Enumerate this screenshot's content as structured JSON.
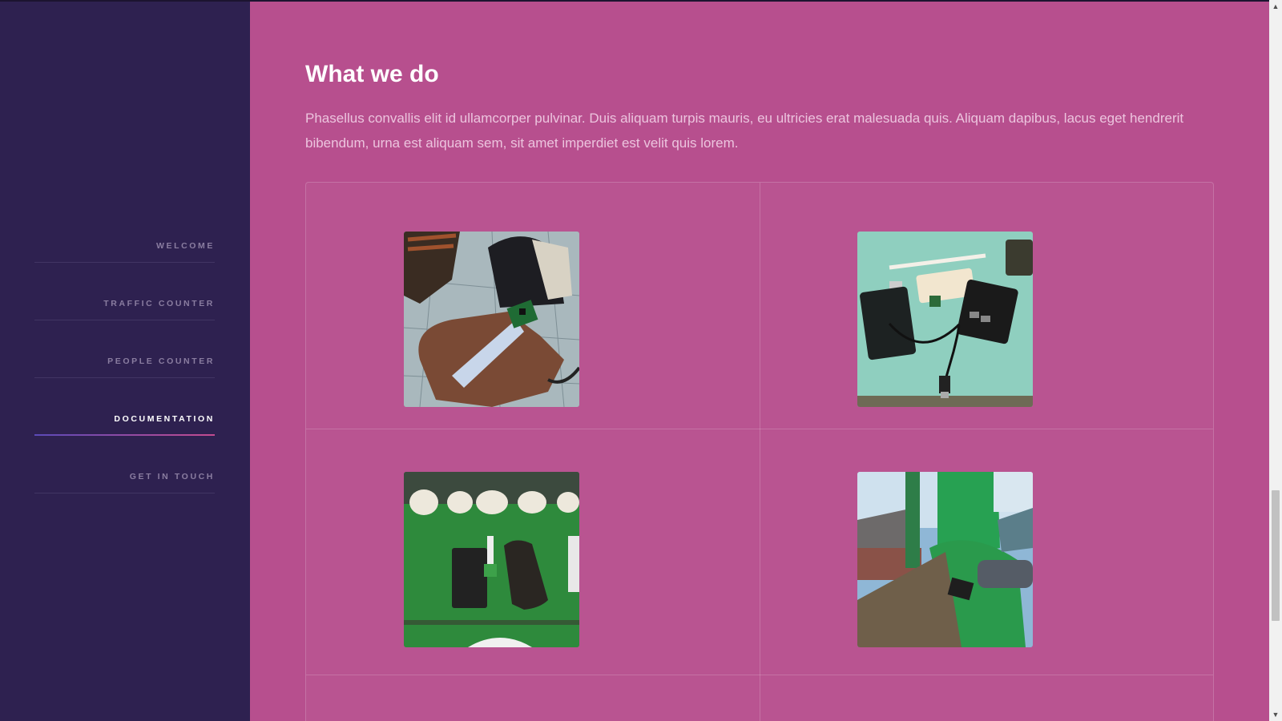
{
  "sidebar": {
    "items": [
      {
        "label": "WELCOME",
        "active": false
      },
      {
        "label": "TRAFFIC COUNTER",
        "active": false
      },
      {
        "label": "PEOPLE COUNTER",
        "active": false
      },
      {
        "label": "DOCUMENTATION",
        "active": true
      },
      {
        "label": "GET IN TOUCH",
        "active": false
      }
    ]
  },
  "main": {
    "title": "What we do",
    "description": "Phasellus convallis elit id ullamcorper pulvinar. Duis aliquam turpis mauris, eu ultricies erat malesuada quis. Aliquam dapibus, lacus eget hendrerit bibendum, urna est aliquam sem, sit amet imperdiet est velit quis lorem."
  },
  "colors": {
    "sidebar_bg": "#2e2150",
    "main_bg": "#b74f8e",
    "active_underline_start": "#5b4ab8",
    "active_underline_end": "#c44c90"
  },
  "icons": {
    "scroll_up": "chevron-up-icon",
    "scroll_down": "chevron-down-icon"
  }
}
